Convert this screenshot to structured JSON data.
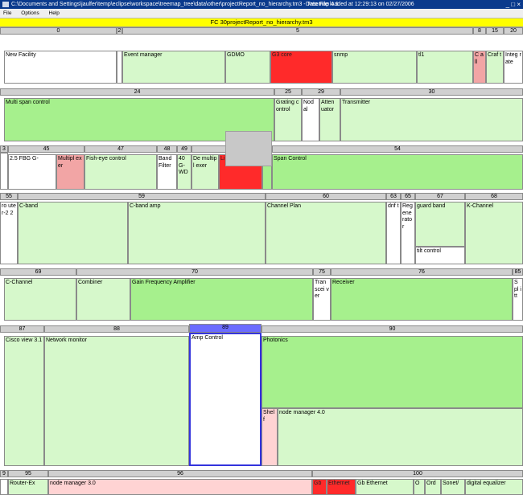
{
  "window": {
    "title": "C:\\Documents and Settings\\jaulfer\\temp\\eclipse\\workspace\\treemap_tree\\data\\other\\projectReport_no_hierarchy.tm3 - Treemap 4.1",
    "status": "Data File loaded at 12:29:13 on 02/27/2006",
    "window_buttons": "_ □ ×"
  },
  "menu": {
    "file": "File",
    "options": "Options",
    "help": "Help"
  },
  "treemap": {
    "title": "FC 30projectReport_no_hierarchy.tm3",
    "headers": {
      "h0": "0",
      "h2": "2",
      "h5": "5",
      "h8": "8",
      "h15": "15",
      "h20": "20",
      "h24": "24",
      "h25": "25",
      "h29": "29",
      "h30": "30",
      "h3": "3",
      "h45": "45",
      "h47": "47",
      "h48": "48",
      "h49": "49",
      "h54": "54",
      "h55": "55",
      "h59": "59",
      "h60": "60",
      "h63": "63",
      "h65": "65",
      "h67": "67",
      "h68": "68",
      "h69": "69",
      "h70": "70",
      "h75": "75",
      "h76": "76",
      "h85": "85",
      "h87": "87",
      "h88": "88",
      "h89": "89",
      "h90": "90",
      "h9": "9",
      "h95": "95",
      "h96": "96",
      "h100": "100"
    },
    "cells": {
      "new_facility": "New Facility",
      "event_manager": "Event manager",
      "gdmo": "GDMO",
      "g3_core": "G3 core",
      "snmp": "snmp",
      "tl1": "tl1",
      "call": "C all",
      "craft": "Craf t",
      "integrate": "Integ rate",
      "multi_span_control": "Multi span control",
      "grating_control": "Grating control",
      "nodal": "Nod al",
      "attenuator": "Atten uator",
      "transmitter": "Transmitter",
      "fbg": "2.5 FBG G-",
      "multiplexer": "Multipl exer",
      "fish_eye_control": "Fish-eye control",
      "band_filter": "Band Filter",
      "g_wdm": "40 G-WD",
      "demultiplexer": "De multipl exer",
      "red_cell": "Li",
      "span_control": "Span Control",
      "router_2": "ro ute r-2 2",
      "c_band": "C-band",
      "c_band_amp": "C-band amp",
      "channel_plan": "Channel Plan",
      "drift": "drif t",
      "regenerator": "Reg ene rato r",
      "guard_band": "guard band",
      "tilt_control": "tilt control",
      "k_channel": "K-Channel",
      "c_channel": "C-Channel",
      "combiner": "Combiner",
      "gain_freq_amp": "Gain Frequency Amplifier",
      "transceiver": "Tran scei ver",
      "receiver": "Receiver",
      "split": "S pl itt",
      "cisco_view": "Cisco view 3.1",
      "network_monitor": "Network monitor",
      "amp_control": "Amp Control",
      "photonics": "Photonics",
      "shelf": "Shel f",
      "node_manager_40": "node manager 4.0",
      "router_ex": "Router-Ex",
      "node_manager_30": "node manager 3.0",
      "gb_1": "Gb",
      "ethernet_1": "Ethernet",
      "gb_ethernet": "Gb Ethernet",
      "o": "O",
      "ord": "Ord",
      "sonet": "Sonet/",
      "digital_equalizer": "digital equalizer"
    }
  },
  "colors": {
    "header_gray": "#d0d0d0",
    "selected_header": "#6b6bff",
    "strong_green": "#a6f08d",
    "light_green": "#d6f8cb",
    "red": "#ff2a2a",
    "pink": "#ffd3d3",
    "title_yellow": "#ffff00"
  }
}
